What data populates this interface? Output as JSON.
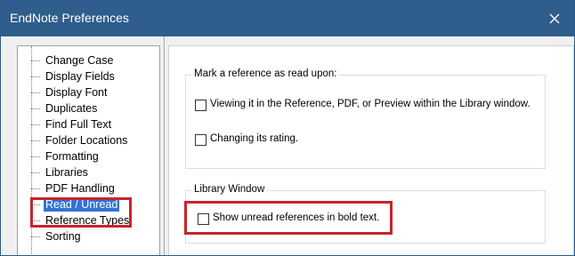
{
  "window": {
    "title": "EndNote Preferences"
  },
  "sidebar": {
    "items": [
      {
        "label": "Change Case"
      },
      {
        "label": "Display Fields"
      },
      {
        "label": "Display Font"
      },
      {
        "label": "Duplicates"
      },
      {
        "label": "Find Full Text"
      },
      {
        "label": "Folder Locations"
      },
      {
        "label": "Formatting"
      },
      {
        "label": "Libraries"
      },
      {
        "label": "PDF Handling"
      },
      {
        "label": "Read / Unread",
        "selected": true
      },
      {
        "label": "Reference Types"
      },
      {
        "label": "Sorting"
      }
    ]
  },
  "mark_read": {
    "legend": "Mark a reference as read upon:",
    "options": [
      {
        "label": "Viewing it in the Reference, PDF, or Preview within the Library window.",
        "checked": false
      },
      {
        "label": "Changing its rating.",
        "checked": false
      }
    ]
  },
  "library_window": {
    "legend": "Library Window",
    "options": [
      {
        "label": "Show unread references in bold text.",
        "checked": false
      }
    ]
  },
  "colors": {
    "titlebar": "#2f5d8c",
    "selection": "#3173d6",
    "highlight": "#c8232c"
  }
}
